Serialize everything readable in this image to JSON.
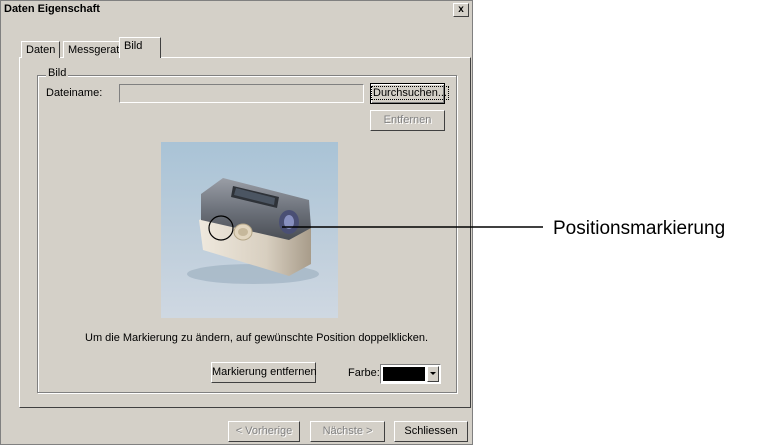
{
  "window": {
    "title": "Daten Eigenschaft",
    "close_glyph": "x"
  },
  "tabs": [
    {
      "label": "Daten",
      "active": false
    },
    {
      "label": "Messgerat",
      "active": false
    },
    {
      "label": "Bild",
      "active": true
    }
  ],
  "group": {
    "legend": "Bild",
    "filename_label": "Dateiname:",
    "filename_value": "",
    "browse_label": "Durchsuchen...",
    "remove_label": "Entfernen",
    "instruction": "Um die Markierung zu ändern, auf gewünschte Position doppelklicken.",
    "remove_marker_label": "Markierung entfernen",
    "color_label": "Farbe:",
    "color_value": "#000000"
  },
  "footer": {
    "prev_label": "< Vorherige",
    "next_label": "Nächste >",
    "close_label": "Schliessen"
  },
  "callout": {
    "label": "Positionsmarkierung"
  },
  "icons": {
    "close": "close-icon",
    "dropdown": "chevron-down-icon",
    "device": "spectrophotometer-image",
    "marker": "position-marker-circle"
  }
}
